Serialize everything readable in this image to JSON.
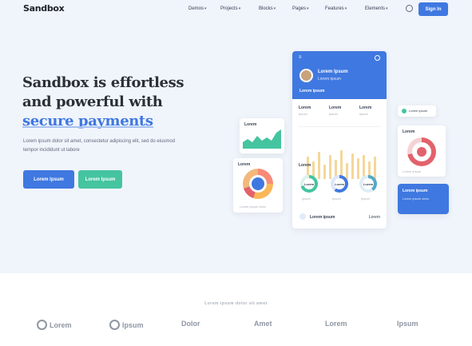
{
  "nav": {
    "logo": "Sandbox",
    "items": [
      {
        "label": "Demos"
      },
      {
        "label": "Projects"
      },
      {
        "label": "Blocks"
      },
      {
        "label": "Pages"
      },
      {
        "label": "Features"
      },
      {
        "label": "Elements"
      }
    ],
    "language_icon": "globe-icon",
    "signin_label": "Sign In"
  },
  "hero": {
    "headline_line1": "Sandbox is effortless",
    "headline_line2": "and powerful with",
    "headline_accent": "secure payments",
    "subtext": "Lorem ipsum dolor sit amet, consectetur adipiscing elit, sed do eiusmod tempor incididunt ut labore",
    "primary_button": "Lorem Ipsum",
    "secondary_button": "Lorem Ipsum"
  },
  "mockup": {
    "phone": {
      "menu_icon": "menu-icon",
      "name": "Lorem Ipsum",
      "subtitle": "Lorem ipsum",
      "balance": "Lorem ipsum",
      "stats": [
        {
          "label": "Lorem",
          "value": "Ipsum"
        },
        {
          "label": "Lorem",
          "value": "Ipsum"
        },
        {
          "label": "Lorem",
          "value": "Ipsum"
        }
      ],
      "section_label": "Lorem",
      "donuts": [
        {
          "value": "Lorem",
          "label": "Ipsum",
          "color": "#45c4a0"
        },
        {
          "value": "Lorem",
          "label": "Ipsum",
          "color": "#3f78e0"
        },
        {
          "value": "Lorem",
          "label": "Ipsum",
          "color": "#54a8c7"
        }
      ],
      "footer_label": "Lorem ipsum",
      "footer_value": "Lorem"
    },
    "green_card_label": "Lorem",
    "pie_card_label": "Lorem",
    "pie_legend": "Lorem ipsum dolor",
    "mini_card_text": "Lorem ipsum",
    "ring_card_label": "Lorem",
    "ring_card_foot": "Lorem ipsum",
    "blue_card_label": "Lorem ipsum",
    "blue_card_sub": "Lorem ipsum dolor"
  },
  "clients": {
    "title": "Lorem ipsum dolor sit amet",
    "brands": [
      "Lorem",
      "Ipsum",
      "Dolor",
      "Amet",
      "Lorem",
      "Ipsum"
    ]
  },
  "colors": {
    "primary": "#3f78e0",
    "green": "#45c4a0",
    "yellow": "#fab758",
    "red": "#e2626b",
    "background": "#f0f4fb"
  }
}
